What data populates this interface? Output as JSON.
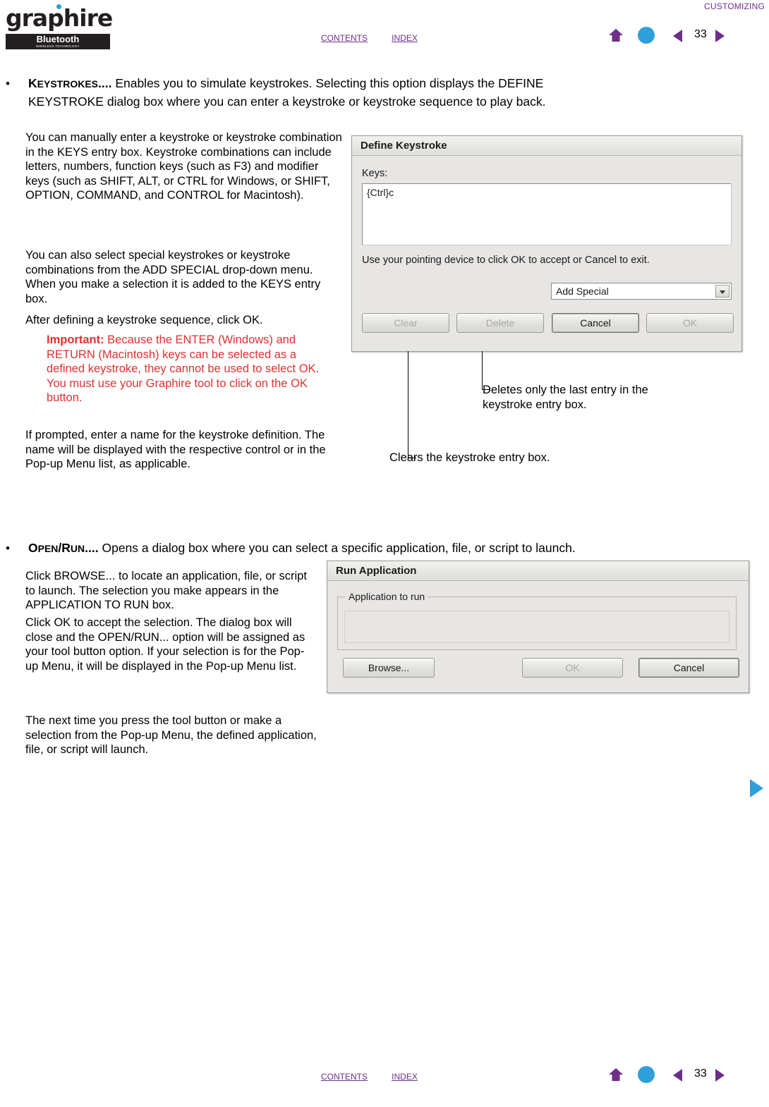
{
  "header": {
    "logo_word": "graphire",
    "logo_bluetooth": "Bluetooth",
    "logo_sub": "WIRELESS TECHNOLOGY",
    "top_caption": "CUSTOMIZING",
    "contents_label": "CONTENTS",
    "index_label": "INDEX",
    "page_number": "33"
  },
  "footer": {
    "contents_label": "CONTENTS",
    "index_label": "INDEX",
    "page_number": "33"
  },
  "bullets": {
    "keystrokes": {
      "term": "KEYSTROKES....",
      "line1_rest": "  Enables you to simulate keystrokes.  Selecting this option displays the DEFINE",
      "line2": "KEYSTROKE dialog box where you can enter a keystroke or keystroke sequence to play back."
    },
    "openrun": {
      "term": "OPEN/RUN....",
      "rest": "  Opens a dialog box where you can select a specific application, file, or script to launch."
    }
  },
  "keystroke_section": {
    "p1": "You can manually enter a keystroke or keystroke combination in the KEYS entry box.  Keystroke combinations can include letters, numbers, function keys (such as F3) and modifier keys (such as SHIFT, ALT, or CTRL for Windows, or SHIFT, OPTION, COMMAND, and CONTROL for Macintosh).",
    "p2": "You can also select special keystrokes or keystroke combinations from the ADD SPECIAL drop-down menu.  When you make a selection it is added to the KEYS entry box.",
    "p3": "After defining a keystroke sequence, click OK.",
    "important_label": "Important:",
    "important_text": " Because the ENTER (Windows) and RETURN (Macintosh) keys can be selected as a defined keystroke, they cannot be used to select OK.  You must use your Graphire tool to click on the OK button.",
    "p4": "If prompted, enter a name for the keystroke definition.  The name will be displayed with the respective control or in the Pop-up Menu list, as applicable."
  },
  "define_keystroke_dialog": {
    "title": "Define Keystroke",
    "keys_label": "Keys:",
    "keys_value": "{Ctrl}c",
    "hint": "Use your pointing device to click OK to accept or Cancel to exit.",
    "add_special_value": "Add Special",
    "buttons": {
      "clear": "Clear",
      "delete": "Delete",
      "cancel": "Cancel",
      "ok": "OK"
    }
  },
  "annotations": {
    "delete_note": "Deletes only the last entry in the keystroke entry box.",
    "clear_note": "Clears the keystroke entry box."
  },
  "openrun_section": {
    "p1": "Click BROWSE... to locate an application, file, or script to launch.  The selection you make appears in the APPLICATION TO RUN box.",
    "p2": "Click OK to accept the selection.  The dialog box will close and the OPEN/RUN... option will be assigned as your tool button option.  If your selection is for the Pop-up Menu, it will be displayed in the Pop-up Menu list.",
    "p3": "The next time you press the tool button or make a selection from the Pop-up Menu, the defined application, file, or script will launch."
  },
  "run_application_dialog": {
    "title": "Run Application",
    "group_label": "Application to run",
    "buttons": {
      "browse": "Browse...",
      "ok": "OK",
      "cancel": "Cancel"
    }
  },
  "colors": {
    "accent_purple": "#6b2f8a",
    "accent_blue": "#2e9fd8",
    "important_red": "#e03030"
  }
}
